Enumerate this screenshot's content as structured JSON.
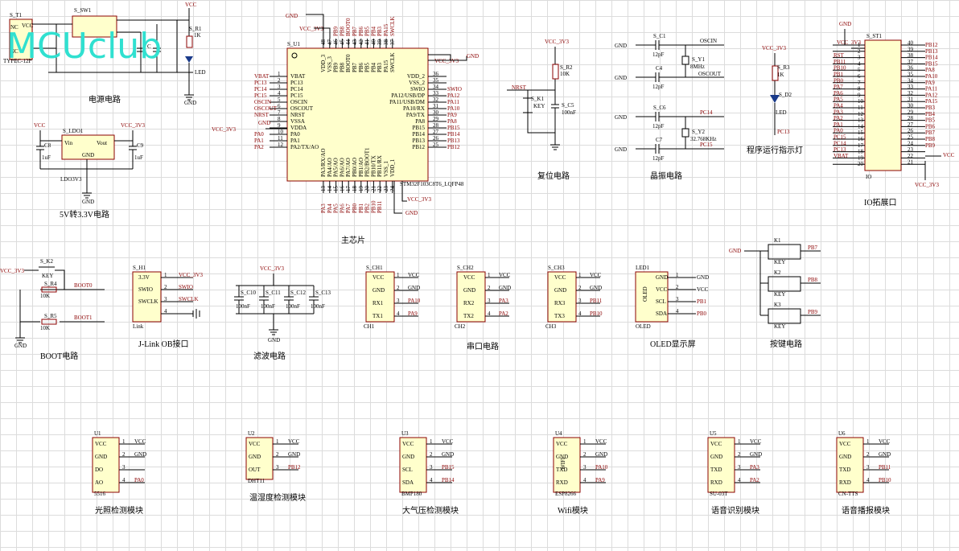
{
  "watermark": "MCUclub",
  "captions": {
    "power": "电源电路",
    "ldo": "5V转3.3V电路",
    "mcu": "主芯片",
    "reset": "复位电路",
    "crystal": "晶振电路",
    "led": "程序运行指示灯",
    "io": "IO拓展口",
    "boot": "BOOT电路",
    "jlink": "J-Link OB接口",
    "filter": "滤波电路",
    "uart": "串口电路",
    "oled": "OLED显示屏",
    "keys": "按键电路",
    "m1": "光照检测模块",
    "m2": "温湿度检测模块",
    "m3": "大气压检测模块",
    "m4": "Wifi模块",
    "m5": "语音识别模块",
    "m6": "语音播报模块"
  },
  "power": {
    "t1": "S_T1",
    "sw1": "S_SW1",
    "r1": "S_R1",
    "r1v": "1K",
    "c": "C",
    "vcc": "VCC",
    "led": "LED",
    "gnd": "GND",
    "usb": "TYPEC-12P",
    "nc": "NC"
  },
  "ldo": {
    "ref": "S_LDO1",
    "vin": "Vin",
    "vout": "Vout",
    "gndpin": "GND",
    "part": "LDO3V3",
    "c8": "C8",
    "c9": "C9",
    "c8v": "1uF",
    "c9v": "1uF",
    "vcc": "VCC",
    "vcc3": "VCC_3V3",
    "gnd": "GND"
  },
  "mcu": {
    "ref": "S_U1",
    "part": "STM32F103C8T6_LQFP48",
    "left_pins": [
      {
        "n": "1",
        "name": "VBAT",
        "net": "VBAT"
      },
      {
        "n": "2",
        "name": "PC13",
        "net": "PC13"
      },
      {
        "n": "3",
        "name": "PC14",
        "net": "PC14"
      },
      {
        "n": "4",
        "name": "PC15",
        "net": "PC15"
      },
      {
        "n": "5",
        "name": "OSCIN",
        "net": "OSCIN"
      },
      {
        "n": "6",
        "name": "OSCOUT",
        "net": "OSCOUT"
      },
      {
        "n": "7",
        "name": "NRST",
        "net": "NRST"
      },
      {
        "n": "8",
        "name": "VSSA",
        "net": "GND"
      },
      {
        "n": "9",
        "name": "VDDA",
        "net": "VCC_3V3"
      },
      {
        "n": "10",
        "name": "PA0",
        "net": "PA0"
      },
      {
        "n": "11",
        "name": "PA1",
        "net": "PA1"
      },
      {
        "n": "12",
        "name": "PA2/TX/AO",
        "net": "PA2"
      }
    ],
    "right_pins": [
      {
        "n": "36",
        "name": "VDD_2",
        "net": "VCC_3V3"
      },
      {
        "n": "35",
        "name": "VSS_2",
        "net": ""
      },
      {
        "n": "34",
        "name": "SWIO",
        "net": "SWIO"
      },
      {
        "n": "33",
        "name": "PA12/USB/DP",
        "net": "PA12"
      },
      {
        "n": "32",
        "name": "PA11/USB/DM",
        "net": "PA11"
      },
      {
        "n": "31",
        "name": "PA10/RX",
        "net": "PA10"
      },
      {
        "n": "30",
        "name": "PA9/TX",
        "net": "PA9"
      },
      {
        "n": "29",
        "name": "PA8",
        "net": "PA8"
      },
      {
        "n": "28",
        "name": "PB15",
        "net": "PB15"
      },
      {
        "n": "27",
        "name": "PB14",
        "net": "PB14"
      },
      {
        "n": "26",
        "name": "PB13",
        "net": "PB13"
      },
      {
        "n": "25",
        "name": "PB12",
        "net": "PB12"
      }
    ],
    "top_pins": [
      "VDD_3",
      "VSS_3",
      "PB9",
      "PB8",
      "BOOT0",
      "PB7",
      "PB6",
      "PB5",
      "PB4",
      "PB3",
      "PA15",
      "SWCLK"
    ],
    "top_nums": [
      "48",
      "47",
      "46",
      "45",
      "44",
      "43",
      "42",
      "41",
      "40",
      "39",
      "38",
      "37"
    ],
    "bottom_pins": [
      "PA3/RX/AO",
      "PA4/AO",
      "PA5/AO",
      "PA6/AO",
      "PA7/AO",
      "PB0/AO",
      "PB1/AO",
      "PB2/BOOT1",
      "PB10/TX",
      "PB11/RX",
      "VSS_1",
      "VDD_1"
    ],
    "bottom_nums": [
      "13",
      "14",
      "15",
      "16",
      "17",
      "18",
      "19",
      "20",
      "21",
      "22",
      "23",
      "24"
    ],
    "vcc3": "VCC_3V3",
    "gnd": "GND"
  },
  "reset": {
    "k1": "S_K1",
    "key": "KEY",
    "r2": "S_R2",
    "r2v": "10K",
    "c5": "S_C5",
    "c5v": "100nF",
    "nrst": "NRST",
    "vcc3": "VCC_3V3"
  },
  "crystal": {
    "c1": "S_C1",
    "c4": "C4",
    "c6": "S_C6",
    "c7": "C7",
    "cv": "12pF",
    "y1": "S_Y1",
    "y1v": "8MHz",
    "y2": "S_Y2",
    "y2v": "32.768KHz",
    "oscin": "OSCIN",
    "oscout": "OSCOUT",
    "pc14": "PC14",
    "pc15": "PC15",
    "gnd": "GND"
  },
  "led": {
    "r3": "S_R3",
    "r3v": "1K",
    "d2": "S_D2",
    "lbl": "LED",
    "net": "PC13",
    "vcc3": "VCC_3V3"
  },
  "io": {
    "ref": "S_ST1",
    "part": "IO",
    "gnd": "GND",
    "vcc3": "VCC_3V3",
    "vcc": "VCC",
    "rows": [
      [
        "",
        "1",
        "40",
        "PB12"
      ],
      [
        "",
        "2",
        "39",
        "PB13"
      ],
      [
        "RST",
        "3",
        "38",
        "PB14"
      ],
      [
        "PB11",
        "4",
        "37",
        "PB15"
      ],
      [
        "PB10",
        "5",
        "36",
        "PA8"
      ],
      [
        "PB1",
        "6",
        "35",
        "PA10"
      ],
      [
        "PB0",
        "7",
        "34",
        "PA9"
      ],
      [
        "PA7",
        "8",
        "33",
        "PA11"
      ],
      [
        "PA6",
        "9",
        "32",
        "PA12"
      ],
      [
        "PA5",
        "10",
        "31",
        "PA15"
      ],
      [
        "PA4",
        "11",
        "30",
        "PB3"
      ],
      [
        "PA3",
        "12",
        "29",
        "PB4"
      ],
      [
        "PA2",
        "13",
        "28",
        "PB5"
      ],
      [
        "PA1",
        "14",
        "27",
        "PB6"
      ],
      [
        "PA0",
        "15",
        "26",
        "PB7"
      ],
      [
        "PC15",
        "16",
        "25",
        "PB8"
      ],
      [
        "PC14",
        "17",
        "24",
        "PB9"
      ],
      [
        "PC13",
        "18",
        "23",
        ""
      ],
      [
        "VBAT",
        "19",
        "22",
        ""
      ],
      [
        "",
        "20",
        "21",
        ""
      ]
    ]
  },
  "boot": {
    "k2": "S_K2",
    "key": "KEY",
    "r4": "S_R4",
    "r5": "S_R5",
    "rv": "10K",
    "boot0": "BOOT0",
    "boot1": "BOOT1",
    "vcc3": "VCC_3V3",
    "gnd": "GND"
  },
  "jlink": {
    "ref": "S_H1",
    "part": "Link",
    "pins": [
      [
        "3.3V",
        "1",
        "VCC_3V3"
      ],
      [
        "SWIO",
        "2",
        "SWIO"
      ],
      [
        "SWCLK",
        "3",
        "SWCLK"
      ],
      [
        "",
        "4",
        ""
      ]
    ]
  },
  "filter": {
    "vcc3": "VCC_3V3",
    "caps": [
      "S_C10",
      "S_C11",
      "S_C12",
      "S_C13"
    ],
    "cv": "100nF",
    "gnd": "GND"
  },
  "uarts": [
    {
      "ref": "S_CH1",
      "part": "CH1",
      "nets": [
        "VCC",
        "GND",
        "PA10",
        "PA9"
      ]
    },
    {
      "ref": "S_CH2",
      "part": "CH2",
      "nets": [
        "VCC",
        "GND",
        "PA3",
        "PA2"
      ]
    },
    {
      "ref": "S_CH3",
      "part": "CH3",
      "nets": [
        "VCC",
        "GND",
        "PB11",
        "PB10"
      ]
    }
  ],
  "uart_pins": [
    "VCC",
    "GND",
    "RX1",
    "TX1"
  ],
  "uart_pins2": [
    "VCC",
    "GND",
    "RX2",
    "TX2"
  ],
  "uart_pins3": [
    "VCC",
    "GND",
    "RX3",
    "TX3"
  ],
  "oled": {
    "ref": "LED1",
    "part": "OLED",
    "body": "OLED",
    "pins": [
      "GND",
      "VCC",
      "SCL",
      "SDA"
    ],
    "nets": [
      "GND",
      "VCC",
      "PB1",
      "PB0"
    ]
  },
  "keys": {
    "gnd": "GND",
    "k": [
      "K1",
      "K2",
      "K3"
    ],
    "key": "KEY",
    "nets": [
      "PB7",
      "PB8",
      "PB9"
    ]
  },
  "modules": [
    {
      "ref": "U1",
      "part": "5516",
      "pins": [
        "VCC",
        "GND",
        "DO",
        "AO"
      ],
      "nets": [
        "VCC",
        "GND",
        "",
        "PA0"
      ]
    },
    {
      "ref": "U2",
      "part": "DHT11",
      "pins": [
        "VCC",
        "GND",
        "OUT"
      ],
      "nets": [
        "VCC",
        "GND",
        "PB12"
      ]
    },
    {
      "ref": "U3",
      "part": "BMP180",
      "pins": [
        "VCC",
        "GND",
        "SCL",
        "SDA"
      ],
      "nets": [
        "VCC",
        "GND",
        "PB15",
        "PB14"
      ]
    },
    {
      "ref": "U4",
      "part": "ESP8266",
      "body": "WIFI",
      "pins": [
        "VCC",
        "GND",
        "TXD",
        "RXD"
      ],
      "nets": [
        "VCC",
        "GND",
        "PA10",
        "PA9"
      ]
    },
    {
      "ref": "U5",
      "part": "SU-03T",
      "pins": [
        "VCC",
        "GND",
        "TXD",
        "RXD"
      ],
      "nets": [
        "VCC",
        "GND",
        "PA3",
        "PA2"
      ]
    },
    {
      "ref": "U6",
      "part": "CN-TTS",
      "pins": [
        "VCC",
        "GND",
        "TXD",
        "RXD"
      ],
      "nets": [
        "VCC",
        "GND",
        "PB11",
        "PB10"
      ]
    }
  ]
}
